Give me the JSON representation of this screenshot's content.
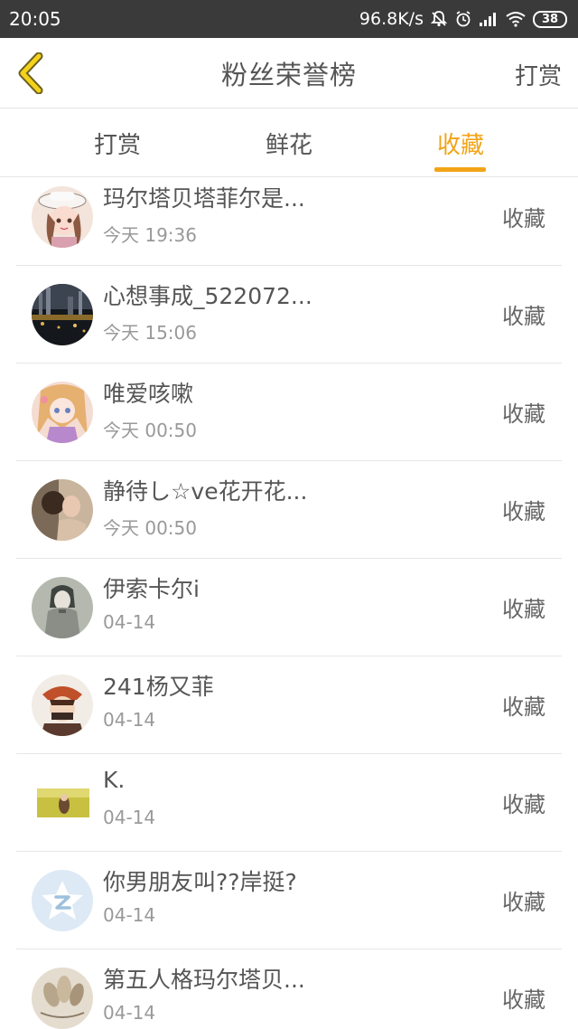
{
  "status_bar": {
    "time": "20:05",
    "net_speed": "96.8K/s",
    "battery": "38",
    "icons": [
      "mute-bell-icon",
      "alarm-icon",
      "signal-icon",
      "wifi-icon",
      "battery-icon"
    ]
  },
  "header": {
    "title": "粉丝荣誉榜",
    "right_action": "打赏",
    "back_icon": "chevron-left-icon"
  },
  "tabs": [
    {
      "label": "打赏",
      "active": false
    },
    {
      "label": "鲜花",
      "active": false
    },
    {
      "label": "收藏",
      "active": true
    }
  ],
  "accent_color": "#f2a417",
  "list": [
    {
      "name": "玛尔塔贝塔菲尔是...",
      "time": "今天 19:36",
      "action": "收藏",
      "avatar": "girl-hat-avatar"
    },
    {
      "name": "心想事成_522072...",
      "time": "今天 15:06",
      "action": "收藏",
      "avatar": "night-city-avatar"
    },
    {
      "name": "唯爱咳嗽",
      "time": "今天 00:50",
      "action": "收藏",
      "avatar": "anime-girl-avatar"
    },
    {
      "name": "静待し☆ve花开花...",
      "time": "今天 00:50",
      "action": "收藏",
      "avatar": "couple-photo-avatar"
    },
    {
      "name": "伊索卡尔i",
      "time": "04-14",
      "action": "收藏",
      "avatar": "sketch-character-avatar"
    },
    {
      "name": "241杨又菲",
      "time": "04-14",
      "action": "收藏",
      "avatar": "red-hat-character-avatar"
    },
    {
      "name": "K.",
      "time": "04-14",
      "action": "收藏",
      "avatar": "field-photo-avatar"
    },
    {
      "name": "你男朋友叫??岸挺?",
      "time": "04-14",
      "action": "收藏",
      "avatar": "default-star-avatar"
    },
    {
      "name": "第五人格玛尔塔贝...",
      "time": "04-14",
      "action": "收藏",
      "avatar": "nails-photo-avatar"
    }
  ]
}
